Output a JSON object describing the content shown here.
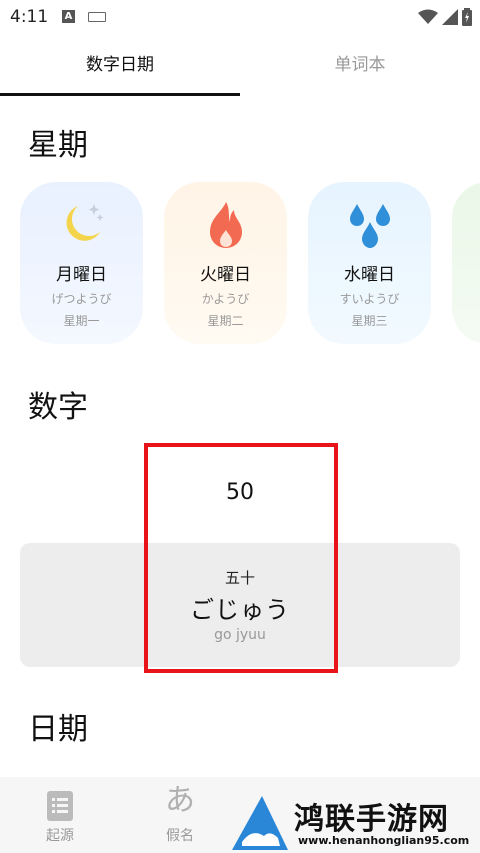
{
  "status_bar": {
    "time": "4:11",
    "notification_letter": "A"
  },
  "tabs": [
    {
      "label": "数字日期"
    },
    {
      "label": "单词本"
    }
  ],
  "sections": {
    "weekday": {
      "title": "星期"
    },
    "number": {
      "title": "数字"
    },
    "date": {
      "title": "日期"
    }
  },
  "weekday_cards": [
    {
      "icon": "moon-stars-icon",
      "name": "月曜日",
      "kana": "げつようび",
      "chinese": "星期一",
      "icon_color": "#f4d44a"
    },
    {
      "icon": "flame-icon",
      "name": "火曜日",
      "kana": "かようび",
      "chinese": "星期二",
      "icon_color": "#f26a52"
    },
    {
      "icon": "water-drops-icon",
      "name": "水曜日",
      "kana": "すいようび",
      "chinese": "星期三",
      "icon_color": "#2f8fd8"
    }
  ],
  "number_card": {
    "value": "50",
    "kanji": "五十",
    "kana": "ごじゅう",
    "romaji": "go jyuu"
  },
  "bottom_nav": [
    {
      "label": "起源",
      "icon": "list-icon"
    },
    {
      "label": "假名",
      "icon": "hiragana-a-icon",
      "glyph": "あ"
    }
  ],
  "watermark": {
    "title": "鸿联手游网",
    "url": "www.henanhonglian95.com"
  },
  "colors": {
    "highlight": "#e8141a",
    "accent_text": "#111111",
    "muted_text": "#999999"
  }
}
